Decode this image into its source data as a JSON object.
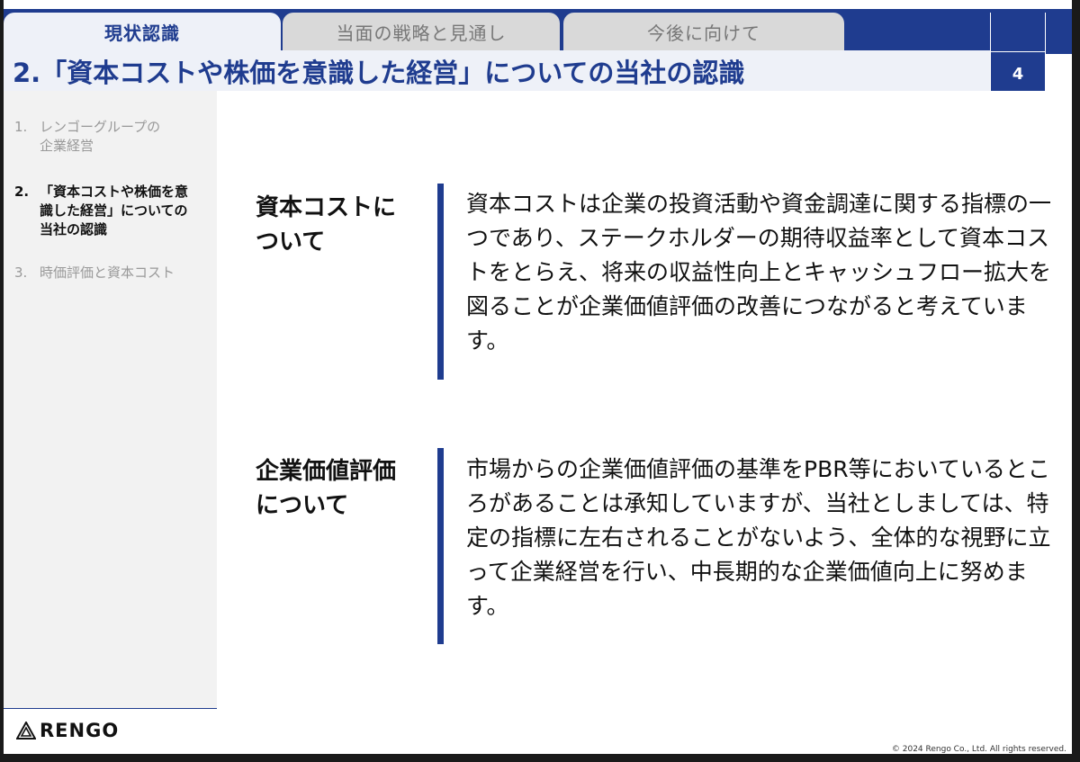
{
  "tabs": [
    {
      "label": "現状認識",
      "active": true
    },
    {
      "label": "当面の戦略と見通し",
      "active": false
    },
    {
      "label": "今後に向けて",
      "active": false
    }
  ],
  "title": "2.「資本コストや株価を意識した経営」についての当社の認識",
  "page_number": "4",
  "sidebar": {
    "items": [
      {
        "num": "1.",
        "label": "レンゴーグループの\n企業経営"
      },
      {
        "num": "2.",
        "label": "「資本コストや株価を意\n識した経営」についての\n当社の認識"
      },
      {
        "num": "3.",
        "label": "時価評価と資本コスト"
      }
    ]
  },
  "sections": [
    {
      "heading": "資本コストに\nついて",
      "body": "資本コストは企業の投資活動や資金調達に関する指標の一つであり、ステークホルダーの期待収益率として資本コストをとらえ、将来の収益性向上とキャッシュフロー拡大を図ることが企業価値評価の改善につながると考えています。"
    },
    {
      "heading": "企業価値評価\nについて",
      "body": "市場からの企業価値評価の基準をPBR等においているところがあることは承知していますが、当社としましては、特定の指標に左右されることがないよう、全体的な視野に立って企業経営を行い、中長期的な企業価値向上に努めます。"
    }
  ],
  "logo": {
    "text": "RENGO",
    "icon": "rengo-triangle-logo"
  },
  "copyright": "© 2024 Rengo Co., Ltd. All rights reserved.",
  "colors": {
    "brand_blue": "#1f3c8f",
    "sidebar_bg": "#f2f2f2",
    "tab_inactive": "#d9d9d9"
  }
}
